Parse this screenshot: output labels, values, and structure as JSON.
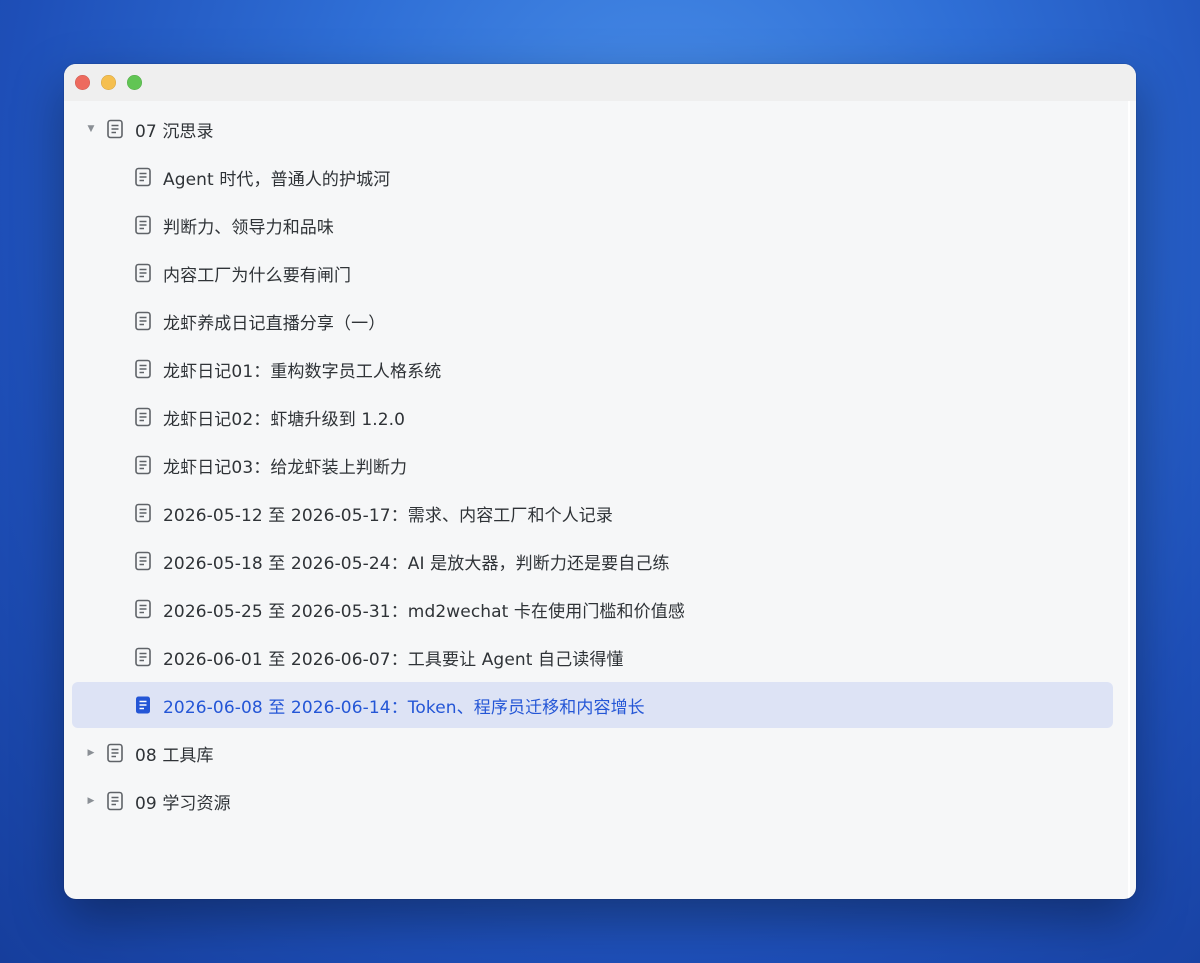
{
  "window": {
    "controls": [
      "close",
      "minimize",
      "maximize"
    ]
  },
  "colors": {
    "selected_bg": "#dde3f5",
    "selected_text": "#2456d6",
    "text": "#2f3337"
  },
  "tree": {
    "folder_07": {
      "label": "07 沉思录",
      "expanded": true,
      "icon": "document-icon"
    },
    "items": [
      "Agent 时代，普通人的护城河",
      "判断力、领导力和品味",
      "内容工厂为什么要有闸门",
      "龙虾养成日记直播分享（一）",
      "龙虾日记01：重构数字员工人格系统",
      "龙虾日记02：虾塘升级到 1.2.0",
      "龙虾日记03：给龙虾装上判断力",
      "2026-05-12 至 2026-05-17：需求、内容工厂和个人记录",
      "2026-05-18 至 2026-05-24：AI 是放大器，判断力还是要自己练",
      "2026-05-25 至 2026-05-31：md2wechat 卡在使用门槛和价值感",
      "2026-06-01 至 2026-06-07：工具要让 Agent 自己读得懂",
      "2026-06-08 至 2026-06-14：Token、程序员迁移和内容增长"
    ],
    "selected_index": 11,
    "folder_08": {
      "label": "08 工具库",
      "expanded": false,
      "icon": "document-icon"
    },
    "folder_09": {
      "label": "09 学习资源",
      "expanded": false,
      "icon": "document-icon"
    }
  }
}
